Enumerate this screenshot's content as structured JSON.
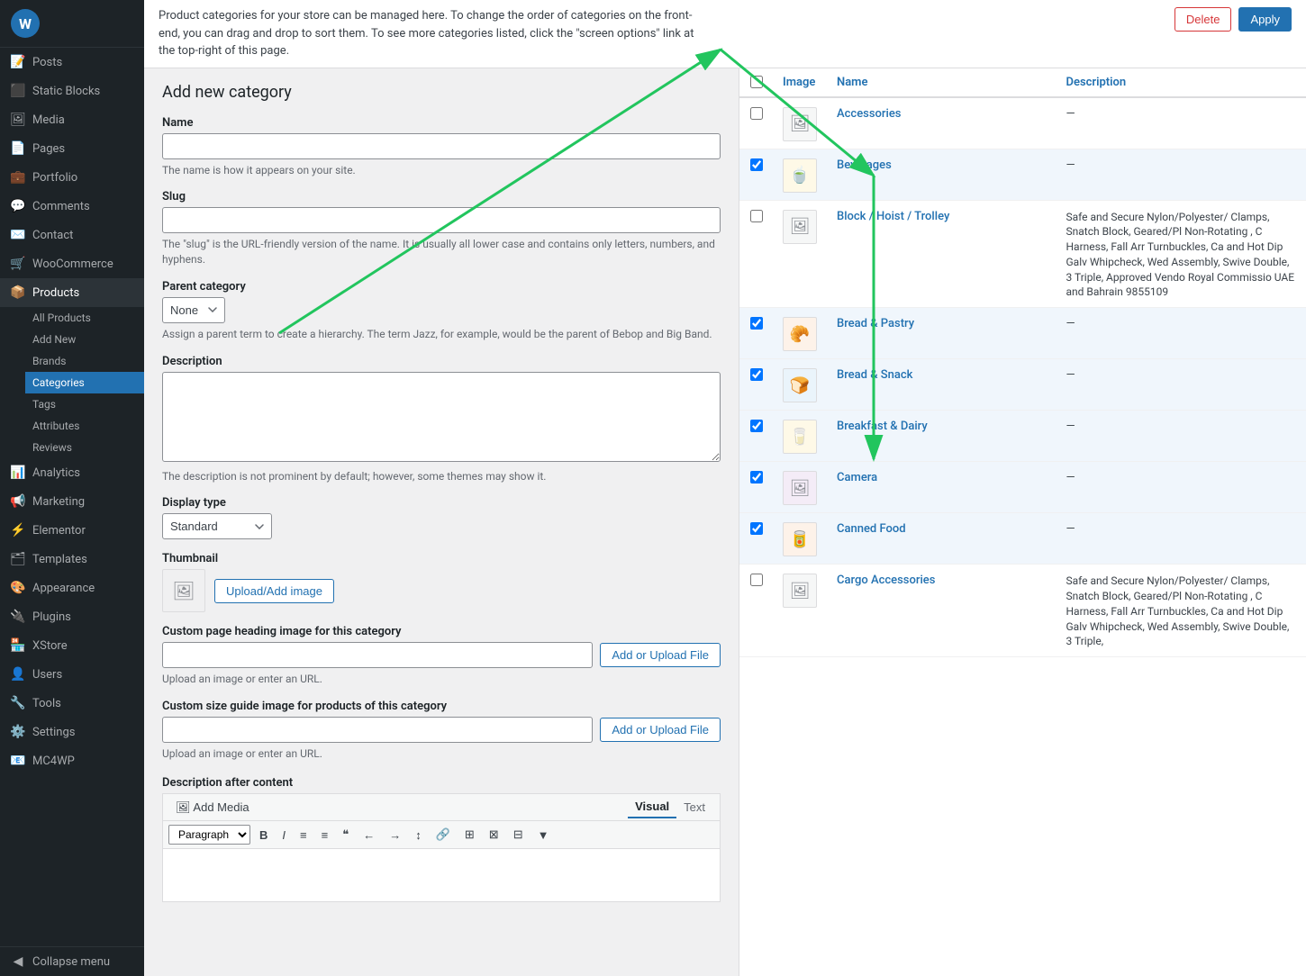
{
  "sidebar": {
    "items": [
      {
        "label": "Posts",
        "icon": "📝",
        "key": "posts"
      },
      {
        "label": "Static Blocks",
        "icon": "⬛",
        "key": "static-blocks"
      },
      {
        "label": "Media",
        "icon": "🖼",
        "key": "media"
      },
      {
        "label": "Pages",
        "icon": "📄",
        "key": "pages"
      },
      {
        "label": "Portfolio",
        "icon": "💼",
        "key": "portfolio"
      },
      {
        "label": "Comments",
        "icon": "💬",
        "key": "comments"
      },
      {
        "label": "Contact",
        "icon": "✉️",
        "key": "contact"
      },
      {
        "label": "WooCommerce",
        "icon": "🛒",
        "key": "woocommerce"
      },
      {
        "label": "Products",
        "icon": "📦",
        "key": "products"
      },
      {
        "label": "Analytics",
        "icon": "📊",
        "key": "analytics"
      },
      {
        "label": "Marketing",
        "icon": "📢",
        "key": "marketing"
      },
      {
        "label": "Elementor",
        "icon": "⚡",
        "key": "elementor"
      },
      {
        "label": "Templates",
        "icon": "🗂",
        "key": "templates"
      },
      {
        "label": "Appearance",
        "icon": "🎨",
        "key": "appearance"
      },
      {
        "label": "Plugins",
        "icon": "🔌",
        "key": "plugins"
      },
      {
        "label": "XStore",
        "icon": "🏪",
        "key": "xstore"
      },
      {
        "label": "Users",
        "icon": "👤",
        "key": "users"
      },
      {
        "label": "Tools",
        "icon": "🔧",
        "key": "tools"
      },
      {
        "label": "Settings",
        "icon": "⚙️",
        "key": "settings"
      },
      {
        "label": "MC4WP",
        "icon": "📧",
        "key": "mc4wp"
      }
    ],
    "sub_products": [
      {
        "label": "All Products",
        "key": "all-products"
      },
      {
        "label": "Add New",
        "key": "add-new"
      },
      {
        "label": "Brands",
        "key": "brands"
      },
      {
        "label": "Categories",
        "key": "categories",
        "active": true
      },
      {
        "label": "Tags",
        "key": "tags"
      },
      {
        "label": "Attributes",
        "key": "attributes"
      },
      {
        "label": "Reviews",
        "key": "reviews"
      }
    ],
    "collapse_label": "Collapse menu"
  },
  "top_bar": {
    "description": "Product categories for your store can be managed here. To change the order of categories on the front-end, you can drag and drop to sort them. To see more categories listed, click the \"screen options\" link at the top-right of this page.",
    "delete_label": "Delete",
    "apply_label": "Apply"
  },
  "form": {
    "section_title": "Add new category",
    "name_label": "Name",
    "name_hint": "The name is how it appears on your site.",
    "slug_label": "Slug",
    "slug_hint": "The \"slug\" is the URL-friendly version of the name. It is usually all lower case and contains only letters, numbers, and hyphens.",
    "parent_label": "Parent category",
    "parent_value": "None",
    "parent_hint": "Assign a parent term to create a hierarchy. The term Jazz, for example, would be the parent of Bebop and Big Band.",
    "description_label": "Description",
    "description_hint": "The description is not prominent by default; however, some themes may show it.",
    "display_type_label": "Display type",
    "display_type_value": "Standard",
    "thumbnail_label": "Thumbnail",
    "upload_btn": "Upload/Add image",
    "custom_heading_label": "Custom page heading image for this category",
    "custom_heading_placeholder": "",
    "custom_heading_hint": "Upload an image or enter an URL.",
    "add_file_label": "Add or Upload File",
    "custom_size_label": "Custom size guide image for products of this category",
    "custom_size_placeholder": "",
    "custom_size_hint": "Upload an image or enter an URL.",
    "desc_after_label": "Description after content",
    "add_media_label": "Add Media",
    "editor_tabs": [
      "Visual",
      "Text"
    ],
    "active_tab": "Visual",
    "format_options": [
      "Paragraph"
    ],
    "editor_btns": [
      "B",
      "I",
      "≡",
      "≡",
      "❝",
      "←",
      "→",
      "↕",
      "🔗",
      "⊞",
      "⊠",
      "⊟",
      "▼"
    ]
  },
  "table": {
    "header": {
      "image_label": "Image",
      "name_label": "Name",
      "desc_label": "Description"
    },
    "rows": [
      {
        "checked": false,
        "has_image": false,
        "name": "Accessories",
        "description": "—"
      },
      {
        "checked": true,
        "has_image": true,
        "image_type": "beverage",
        "image_emoji": "🍵",
        "name": "Beverages",
        "description": "—"
      },
      {
        "checked": false,
        "has_image": false,
        "name": "Block / Hoist / Trolley",
        "description": "Safe and Secure Nylon/Polyester/ Clamps, Snatch Block, Geared/Pl Non-Rotating , C Harness, Fall Arr Turnbuckles, Ca and Hot Dip Galv Whipcheck, Wed Assembly, Swive Double, 3 Triple, Approved Vendo Royal Commissio UAE and Bahrain 9855109"
      },
      {
        "checked": true,
        "has_image": true,
        "image_type": "bread",
        "image_emoji": "🥐",
        "name": "Bread & Pastry",
        "description": "—"
      },
      {
        "checked": true,
        "has_image": true,
        "image_type": "snack",
        "image_emoji": "🍞",
        "name": "Bread & Snack",
        "description": "—"
      },
      {
        "checked": true,
        "has_image": true,
        "image_type": "dairy",
        "image_emoji": "🥛",
        "name": "Breakfast & Dairy",
        "description": "—"
      },
      {
        "checked": true,
        "has_image": false,
        "name": "Camera",
        "description": "—"
      },
      {
        "checked": true,
        "has_image": true,
        "image_type": "canned",
        "image_emoji": "🥫",
        "name": "Canned Food",
        "description": "—"
      },
      {
        "checked": false,
        "has_image": false,
        "name": "Cargo Accessories",
        "description": "Safe and Secure Nylon/Polyester/ Clamps, Snatch Block, Geared/Pl Non-Rotating , C Harness, Fall Arr Turnbuckles, Ca and Hot Dip Galv Whipcheck, Wed Assembly, Swive Double, 3 Triple,"
      }
    ]
  }
}
